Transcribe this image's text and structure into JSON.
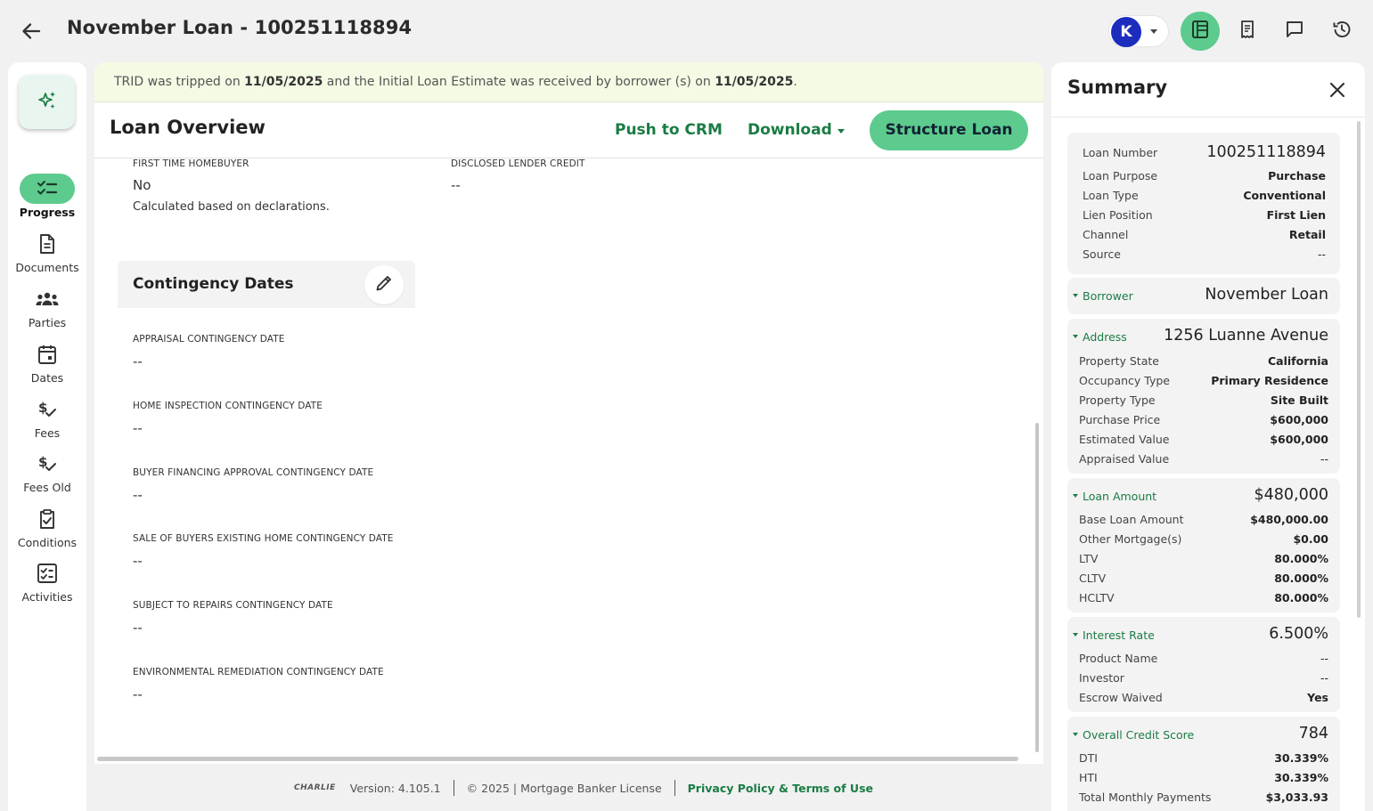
{
  "header": {
    "title": "November Loan - 100251118894",
    "user_initial": "K"
  },
  "nav": {
    "items": [
      {
        "label": "Progress",
        "icon": "progress-checklist-icon",
        "active": true
      },
      {
        "label": "Documents",
        "icon": "document-icon"
      },
      {
        "label": "Parties",
        "icon": "people-icon"
      },
      {
        "label": "Dates",
        "icon": "calendar-icon"
      },
      {
        "label": "Fees",
        "icon": "dollar-check-icon"
      },
      {
        "label": "Fees Old",
        "icon": "dollar-check-icon"
      },
      {
        "label": "Conditions",
        "icon": "clipboard-check-icon"
      },
      {
        "label": "Activities",
        "icon": "checkbox-list-icon"
      }
    ]
  },
  "trid": {
    "p1": "TRID was tripped on ",
    "date1": "11/05/2025",
    "p2": " and the Initial Loan Estimate was received by borrower (s) on ",
    "date2": "11/05/2025",
    "p3": "."
  },
  "overview": {
    "title": "Loan Overview",
    "push_crm": "Push to CRM",
    "download": "Download",
    "structure": "Structure Loan",
    "first_time_label": "FIRST TIME HOMEBUYER",
    "first_time_value": "No",
    "first_time_note": "Calculated based on declarations.",
    "lender_credit_label": "DISCLOSED LENDER CREDIT",
    "lender_credit_value": "--"
  },
  "contingency": {
    "title": "Contingency Dates",
    "fields": [
      {
        "label": "APPRAISAL CONTINGENCY DATE",
        "value": "--"
      },
      {
        "label": "HOME INSPECTION CONTINGENCY DATE",
        "value": "--"
      },
      {
        "label": "BUYER FINANCING APPROVAL CONTINGENCY DATE",
        "value": "--"
      },
      {
        "label": "SALE OF BUYERS EXISTING HOME CONTINGENCY DATE",
        "value": "--"
      },
      {
        "label": "SUBJECT TO REPAIRS CONTINGENCY DATE",
        "value": "--"
      },
      {
        "label": "ENVIRONMENTAL REMEDIATION CONTINGENCY DATE",
        "value": "--"
      }
    ]
  },
  "footer": {
    "logo": "CHARLIE",
    "version": "Version: 4.105.1",
    "copyright": "© 2025 | Mortgage Banker License",
    "policy": "Privacy Policy & Terms of Use"
  },
  "summary": {
    "title": "Summary",
    "loan": [
      {
        "k": "Loan Number",
        "v": "100251118894"
      },
      {
        "k": "Loan Purpose",
        "v": "Purchase"
      },
      {
        "k": "Loan Type",
        "v": "Conventional"
      },
      {
        "k": "Lien Position",
        "v": "First Lien"
      },
      {
        "k": "Channel",
        "v": "Retail"
      },
      {
        "k": "Source",
        "v": "--"
      }
    ],
    "borrower": {
      "k": "Borrower",
      "v": "November Loan"
    },
    "address": {
      "k": "Address",
      "v": "1256 Luanne Avenue",
      "rows": [
        {
          "k": "Property State",
          "v": "California"
        },
        {
          "k": "Occupancy Type",
          "v": "Primary Residence"
        },
        {
          "k": "Property Type",
          "v": "Site Built"
        },
        {
          "k": "Purchase Price",
          "v": "$600,000"
        },
        {
          "k": "Estimated Value",
          "v": "$600,000"
        },
        {
          "k": "Appraised Value",
          "v": "--"
        }
      ]
    },
    "loan_amount": {
      "k": "Loan Amount",
      "v": "$480,000",
      "rows": [
        {
          "k": "Base Loan Amount",
          "v": "$480,000.00"
        },
        {
          "k": "Other Mortgage(s)",
          "v": "$0.00"
        },
        {
          "k": "LTV",
          "v": "80.000%"
        },
        {
          "k": "CLTV",
          "v": "80.000%"
        },
        {
          "k": "HCLTV",
          "v": "80.000%"
        }
      ]
    },
    "interest_rate": {
      "k": "Interest Rate",
      "v": "6.500%",
      "rows": [
        {
          "k": "Product Name",
          "v": "--"
        },
        {
          "k": "Investor",
          "v": "--"
        },
        {
          "k": "Escrow Waived",
          "v": "Yes"
        }
      ]
    },
    "credit": {
      "k": "Overall Credit Score",
      "v": "784",
      "rows": [
        {
          "k": "DTI",
          "v": "30.339%"
        },
        {
          "k": "HTI",
          "v": "30.339%"
        },
        {
          "k": "Total Monthly Payments",
          "v": "$3,033.93"
        }
      ]
    }
  }
}
